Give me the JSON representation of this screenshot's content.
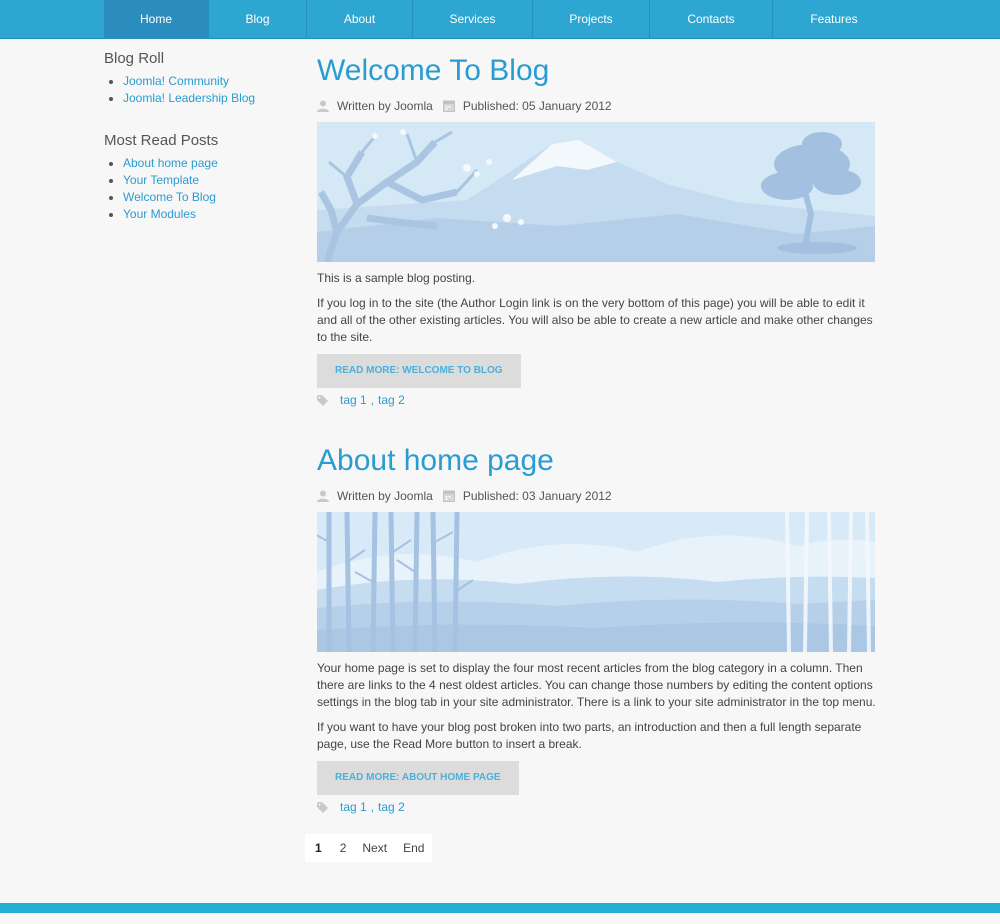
{
  "nav": {
    "items": [
      {
        "label": "Home",
        "active": true
      },
      {
        "label": "Blog"
      },
      {
        "label": "About"
      },
      {
        "label": "Services"
      },
      {
        "label": "Projects"
      },
      {
        "label": "Contacts"
      },
      {
        "label": "Features"
      }
    ],
    "colors": {
      "bar": "#2ea6d2",
      "active": "#2b8dbd"
    }
  },
  "sidebar": {
    "blog_roll": {
      "title": "Blog Roll",
      "links": [
        "Joomla! Community",
        "Joomla! Leadership Blog"
      ]
    },
    "most_read": {
      "title": "Most Read Posts",
      "links": [
        "About home page",
        "Your Template",
        "Welcome To Blog",
        "Your Modules"
      ]
    }
  },
  "posts": [
    {
      "title": "Welcome To Blog",
      "author": "Written by Joomla",
      "published": "Published: 05 January 2012",
      "paragraphs": [
        "This is a sample blog posting.",
        "If you log in to the site (the Author Login link is on the very bottom of this page) you will be able to edit it and all of the other existing articles. You will also be able to create a new article and make other changes to the site."
      ],
      "read_more": "READ MORE: WELCOME TO BLOG",
      "tags": [
        "tag 1",
        "tag 2"
      ]
    },
    {
      "title": "About home page",
      "author": "Written by Joomla",
      "published": "Published: 03 January 2012",
      "paragraphs": [
        "Your home page is set to display the four most recent articles from the blog category in a column. Then there are links to the 4 nest oldest articles. You can change those numbers by editing the content options settings in the blog tab in your site administrator. There is a link to your site administrator in the top menu.",
        "If you want to have your blog post broken into two parts, an introduction and then a full length separate page, use the Read More button to insert a break."
      ],
      "read_more": "READ MORE: ABOUT HOME PAGE",
      "tags": [
        "tag 1",
        "tag 2"
      ]
    }
  ],
  "pagination": {
    "current": "1",
    "pages": [
      "2"
    ],
    "next": "Next",
    "end": "End"
  },
  "icons": {
    "author": "user-icon",
    "published": "calendar-icon",
    "tags": "tag-icon"
  },
  "colors": {
    "link": "#2a9ccf",
    "footer": "#23b0d7",
    "readmore_bg": "#dcdcdc"
  }
}
